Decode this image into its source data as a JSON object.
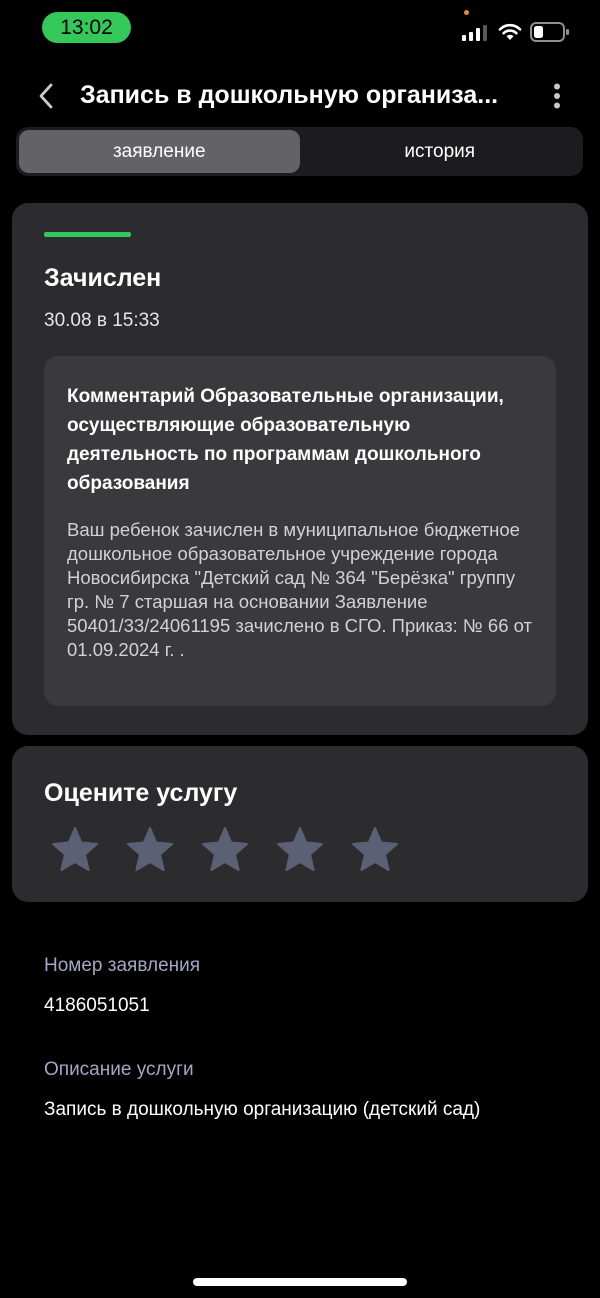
{
  "status_bar": {
    "time": "13:02",
    "colors": {
      "time_pill": "#34c759",
      "privacy_dot": "#e3902f"
    },
    "icons": [
      "signal-icon",
      "wifi-icon",
      "battery-icon"
    ]
  },
  "header": {
    "title": "Запись в дошкольную организа...",
    "icons": {
      "back": "chevron-left-icon",
      "more": "more-vertical-icon"
    }
  },
  "tabs": [
    {
      "label": "заявление",
      "active": true
    },
    {
      "label": "история",
      "active": false
    }
  ],
  "status": {
    "title": "Зачислен",
    "date": "30.08 в 15:33",
    "accent_color": "#34c759",
    "comment": {
      "title": "Комментарий Образовательные организации, осуществляющие образовательную деятельность по программам дошкольного образования",
      "body": "Ваш ребенок зачислен в муниципальное бюджетное дошкольное образовательное учреждение города Новосибирска \"Детский сад № 364 \"Берёзка\" группу гр. № 7 старшая на основании Заявление 50401/33/24061195 зачислено в СГО. Приказ: № 66 от 01.09.2024 г. ."
    }
  },
  "rating": {
    "title": "Оцените услугу",
    "max_stars": 5,
    "selected": 0,
    "icon": "star-icon"
  },
  "info": {
    "application_number_label": "Номер заявления",
    "application_number": "4186051051",
    "service_description_label": "Описание услуги",
    "service_description": "Запись в дошкольную организацию (детский сад)"
  }
}
